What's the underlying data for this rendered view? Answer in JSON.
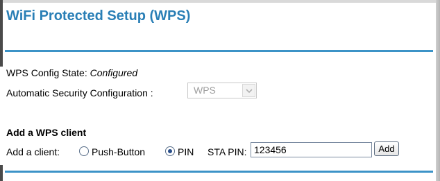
{
  "page": {
    "title": "WiFi Protected Setup (WPS)"
  },
  "wps": {
    "config_state_label": "WPS Config State:",
    "config_state_value": "Configured",
    "auto_security_label": "Automatic Security Configuration :",
    "auto_security_value": "WPS"
  },
  "add_client": {
    "heading": "Add a WPS client",
    "label": "Add a client:",
    "options": [
      {
        "label": "Push-Button",
        "selected": false
      },
      {
        "label": "PIN",
        "selected": true
      }
    ],
    "sta_pin_label": "STA PIN:",
    "sta_pin_value": "123456",
    "add_button_label": "Add"
  },
  "colors": {
    "title": "#2a7fb6",
    "rule": "#3c93c7"
  }
}
